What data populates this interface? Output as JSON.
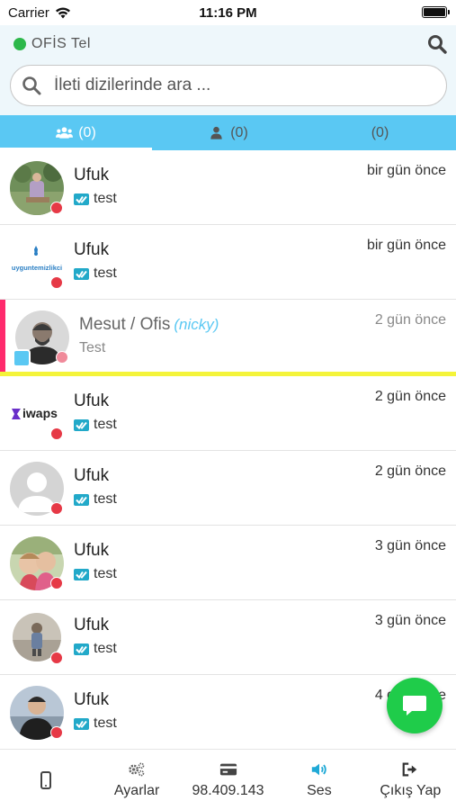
{
  "status_bar": {
    "carrier": "Carrier",
    "time": "11:16 PM"
  },
  "header": {
    "line_name": "OFİS Tel",
    "online_color": "#2db84b"
  },
  "search": {
    "placeholder": "İleti dizilerinde ara ..."
  },
  "tabs": [
    {
      "icon": "users-icon",
      "count": "(0)",
      "active": true
    },
    {
      "icon": "user-icon",
      "count": "(0)",
      "active": false
    },
    {
      "icon": "",
      "count": "(0)",
      "active": false
    }
  ],
  "conversations": [
    {
      "name": "Ufuk",
      "message": "test",
      "time": "bir gün önce",
      "avatar": "garden-photo"
    },
    {
      "name": "Ufuk",
      "message": "test",
      "time": "bir gün önce",
      "avatar": "uygun-temizlikci-logo",
      "avatar_text": "uyguntemizlikci"
    },
    {
      "name": "Mesut / Ofis",
      "nick": "(nicky)",
      "message": "Test",
      "time": "2 gün önce",
      "avatar": "man-photo",
      "highlighted": true
    },
    {
      "name": "Ufuk",
      "message": "test",
      "time": "2 gün önce",
      "avatar": "iwaps-logo",
      "avatar_text": "iwaps"
    },
    {
      "name": "Ufuk",
      "message": "test",
      "time": "2 gün önce",
      "avatar": "default-avatar"
    },
    {
      "name": "Ufuk",
      "message": "test",
      "time": "3 gün önce",
      "avatar": "children-photo"
    },
    {
      "name": "Ufuk",
      "message": "test",
      "time": "3 gün önce",
      "avatar": "child-standing-photo"
    },
    {
      "name": "Ufuk",
      "message": "test",
      "time": "4 gün önce",
      "avatar": "young-man-photo"
    }
  ],
  "bottom_bar": {
    "settings_label": "Ayarlar",
    "balance_label": "98.409.143",
    "sound_label": "Ses",
    "logout_label": "Çıkış Yap"
  },
  "colors": {
    "accent": "#5ac8f3",
    "unread_dot": "#e63946",
    "fab": "#1fcc4a",
    "highlight_left": "#ff2a6d",
    "highlight_bottom": "#f4f43a"
  }
}
